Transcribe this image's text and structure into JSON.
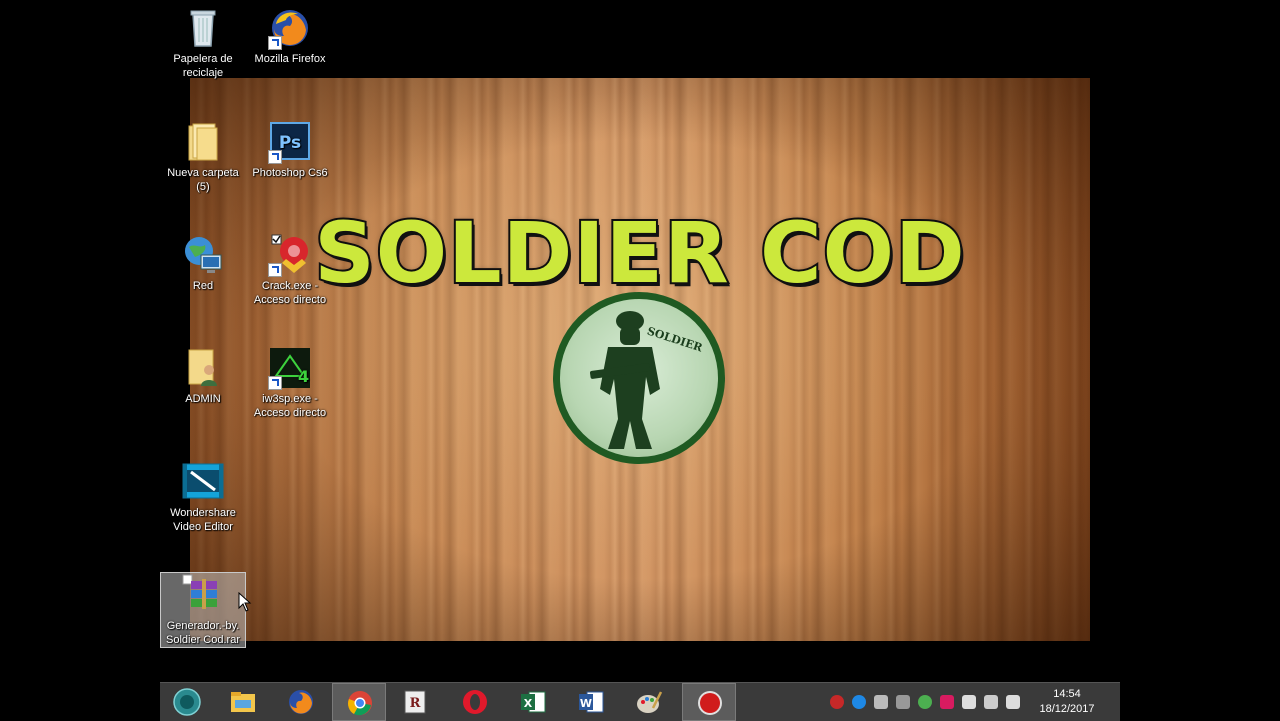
{
  "desktop_icons": [
    {
      "name": "recycle-bin",
      "label": "Papelera de reciclaje"
    },
    {
      "name": "firefox",
      "label": "Mozilla Firefox"
    },
    {
      "name": "folder",
      "label": "Nueva carpeta (5)"
    },
    {
      "name": "photoshop",
      "label": "Photoshop Cs6"
    },
    {
      "name": "network",
      "label": "Red"
    },
    {
      "name": "crack",
      "label": "Crack.exe - Acceso directo"
    },
    {
      "name": "admin",
      "label": "ADMIN"
    },
    {
      "name": "iw3sp",
      "label": "iw3sp.exe - Acceso directo"
    },
    {
      "name": "wondershare",
      "label": "Wondershare Video Editor"
    },
    {
      "name": "rar",
      "label": "Generador.-by. Soldier Cod.rar"
    }
  ],
  "wallpaper": {
    "title": "SOLDIER COD",
    "emblem_text": "SOLDIER",
    "title_color": "#cce83c"
  },
  "taskbar": {
    "apps": [
      "start",
      "file-explorer",
      "firefox",
      "chrome",
      "winrar",
      "opera",
      "excel",
      "word",
      "paint",
      "recorder"
    ],
    "active": "chrome"
  },
  "clock": {
    "time": "14:54",
    "date": "18/12/2017"
  }
}
